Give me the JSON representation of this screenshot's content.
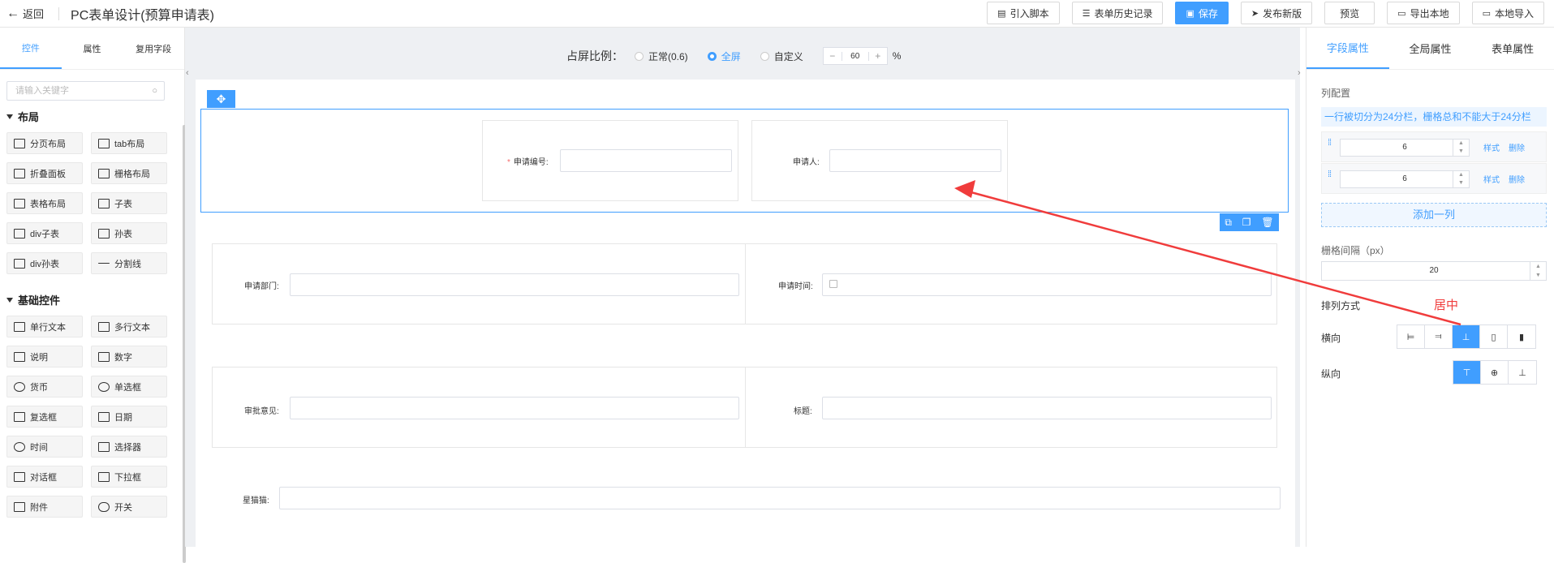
{
  "header": {
    "back_label": "返回",
    "title": "PC表单设计(预算申请表)",
    "buttons": [
      {
        "label": "引入脚本",
        "icon": "▤"
      },
      {
        "label": "表单历史记录",
        "icon": "☰"
      },
      {
        "label": "保存",
        "icon": "▣"
      },
      {
        "label": "发布新版",
        "icon": "➤"
      },
      {
        "label": "预览",
        "icon": ""
      },
      {
        "label": "导出本地",
        "icon": "▭"
      },
      {
        "label": "本地导入",
        "icon": "▭"
      }
    ]
  },
  "left": {
    "tabs": [
      "控件",
      "属性",
      "复用字段"
    ],
    "search_placeholder": "请输入关键字",
    "groups": [
      {
        "name": "布局",
        "items": [
          "分页布局",
          "tab布局",
          "折叠面板",
          "栅格布局",
          "表格布局",
          "子表",
          "div子表",
          "孙表",
          "div孙表",
          "分割线"
        ]
      },
      {
        "name": "基础控件",
        "items": [
          "单行文本",
          "多行文本",
          "说明",
          "数字",
          "货币",
          "单选框",
          "复选框",
          "日期",
          "时间",
          "选择器",
          "对话框",
          "下拉框",
          "附件",
          "开关"
        ]
      }
    ]
  },
  "center": {
    "ratio_label": "占屏比例：",
    "options": [
      "正常(0.6)",
      "全屏",
      "自定义"
    ],
    "selected_option": "全屏",
    "ratio_value": "60",
    "percent": "%",
    "minus": "−",
    "plus": "+",
    "fields": {
      "apply_no": "申请编号:",
      "applicant": "申请人:",
      "dept": "申请部门:",
      "apply_time": "申请时间:",
      "opinion": "审批意见:",
      "title": "标题:",
      "note": "星猫猫:"
    }
  },
  "right": {
    "tabs": [
      "字段属性",
      "全局属性",
      "表单属性"
    ],
    "col_config": "列配置",
    "col_info": "一行被切分为24分栏，栅格总和不能大于24分栏",
    "columns": [
      "6",
      "6"
    ],
    "style_link": "样式",
    "delete_link": "删除",
    "add_col": "添加一列",
    "gap_label": "栅格间隔（px）",
    "gap_value": "20",
    "align_label": "排列方式",
    "horizontal": "横向",
    "vertical": "纵向",
    "annotation": "居中"
  },
  "colors": {
    "primary": "#409eff",
    "annotation": "#f03c3c"
  }
}
